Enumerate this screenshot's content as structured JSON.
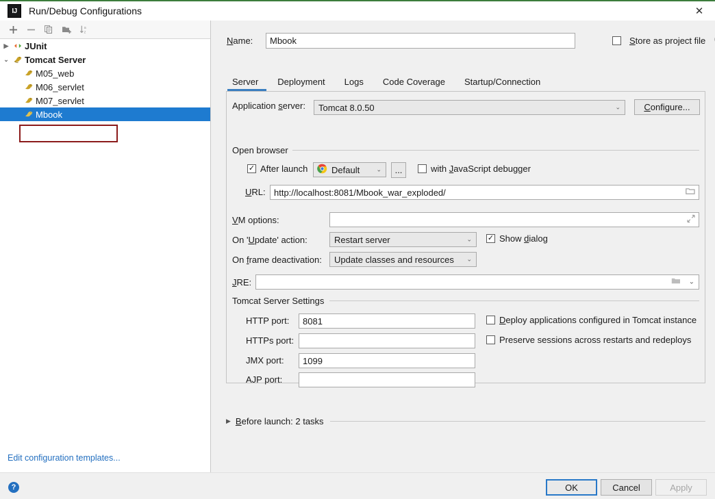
{
  "window": {
    "title": "Run/Debug Configurations",
    "logo_text": "IJ",
    "close_label": "✕",
    "accent_color": "#3c7d3c"
  },
  "left_panel": {
    "toolbar": [
      {
        "name": "add-button",
        "icon": "plus-icon",
        "label": "+"
      },
      {
        "name": "remove-button",
        "icon": "minus-icon",
        "label": "−"
      },
      {
        "name": "copy-button",
        "icon": "copy-icon",
        "label": "Copy Configuration"
      },
      {
        "name": "folder-button",
        "icon": "new-folder-icon",
        "label": "Create New Folder"
      },
      {
        "name": "sort-button",
        "icon": "sort-alphabetically-icon",
        "label": "Sort Configurations"
      }
    ],
    "tree": [
      {
        "label": "JUnit",
        "type": "group",
        "expanded": false,
        "twisty": "▶",
        "icon": "junit-icon"
      },
      {
        "label": "Tomcat Server",
        "type": "group",
        "expanded": true,
        "twisty": "⌄",
        "icon": "tomcat-icon"
      },
      {
        "label": "M05_web",
        "type": "child",
        "icon": "tomcat-icon"
      },
      {
        "label": "M06_servlet",
        "type": "child",
        "icon": "tomcat-icon"
      },
      {
        "label": "M07_servlet",
        "type": "child",
        "icon": "tomcat-icon"
      },
      {
        "label": "Mbook",
        "type": "child",
        "icon": "tomcat-icon",
        "selected": true,
        "annotated": true
      }
    ],
    "edit_templates_link": "Edit configuration templates...",
    "selection_color": "#1e7bd0",
    "annotation_color": "#8b1a1a"
  },
  "main": {
    "name_label": "Name:",
    "name_value": "Mbook",
    "store_as_project_file": {
      "label": "Store as project file",
      "checked": false,
      "gear_icon": "gear-icon"
    },
    "tabs": [
      {
        "label": "Server",
        "active": true
      },
      {
        "label": "Deployment",
        "active": false
      },
      {
        "label": "Logs",
        "active": false
      },
      {
        "label": "Code Coverage",
        "active": false
      },
      {
        "label": "Startup/Connection",
        "active": false
      }
    ],
    "active_tab_color": "#3a7ec0",
    "application_server": {
      "label": "Application server:",
      "value": "Tomcat 8.0.50",
      "configure_button": "Configure..."
    },
    "open_browser": {
      "group_label": "Open browser",
      "after_launch": {
        "label": "After launch",
        "checked": true
      },
      "browser": {
        "value": "Default",
        "icon": "chrome-icon"
      },
      "browse_button": "...",
      "js_debugger": {
        "label": "with JavaScript debugger",
        "checked": false
      },
      "url_label": "URL:",
      "url_value": "http://localhost:8081/Mbook_war_exploded/",
      "url_browse_icon": "folder-icon"
    },
    "vm_options": {
      "label": "VM options:",
      "value": "",
      "expand_icon": "expand-icon"
    },
    "on_update_action": {
      "label": "On 'Update' action:",
      "value": "Restart server"
    },
    "show_dialog": {
      "label": "Show dialog",
      "checked": true
    },
    "on_frame_deactivation": {
      "label": "On frame deactivation:",
      "value": "Update classes and resources"
    },
    "jre": {
      "label": "JRE:",
      "value": "",
      "folder_icon": "folder-icon",
      "chevron_icon": "chevron-down-icon"
    },
    "tomcat_settings": {
      "group_label": "Tomcat Server Settings",
      "ports": [
        {
          "label": "HTTP port:",
          "value": "8081",
          "name": "http-port"
        },
        {
          "label": "HTTPs port:",
          "value": "",
          "name": "https-port"
        },
        {
          "label": "JMX port:",
          "value": "1099",
          "name": "jmx-port"
        },
        {
          "label": "AJP port:",
          "value": "",
          "name": "ajp-port"
        }
      ],
      "deploy_applications": {
        "label": "Deploy applications configured in Tomcat instance",
        "checked": false
      },
      "preserve_sessions": {
        "label": "Preserve sessions across restarts and redeploys",
        "checked": false
      }
    },
    "before_launch": {
      "label": "Before launch: 2 tasks",
      "triangle": "▶",
      "expanded": false
    }
  },
  "footer": {
    "help_label": "?",
    "buttons": [
      {
        "label": "OK",
        "name": "ok-button",
        "style": "default"
      },
      {
        "label": "Cancel",
        "name": "cancel-button",
        "style": "normal"
      },
      {
        "label": "Apply",
        "name": "apply-button",
        "style": "disabled"
      }
    ]
  }
}
